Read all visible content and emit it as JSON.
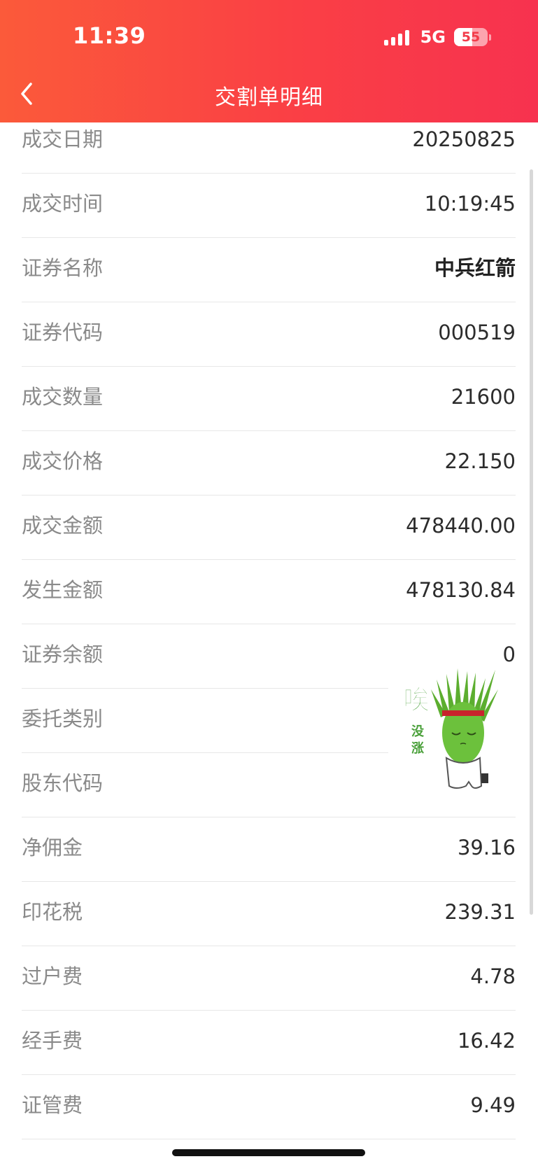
{
  "status_bar": {
    "time": "11:39",
    "network": "5G",
    "battery_level": "55",
    "battery_fraction": 0.55
  },
  "header": {
    "back_icon": "chevron-left-icon",
    "title": "交割单明细",
    "gradient_colors": [
      "#fb5a3a",
      "#f7324f"
    ]
  },
  "details": [
    {
      "key": "trade-date",
      "label": "成交日期",
      "value": "20250825"
    },
    {
      "key": "trade-time",
      "label": "成交时间",
      "value": "10:19:45"
    },
    {
      "key": "security-name",
      "label": "证券名称",
      "value": "中兵红箭"
    },
    {
      "key": "security-code",
      "label": "证券代码",
      "value": "000519"
    },
    {
      "key": "trade-quantity",
      "label": "成交数量",
      "value": "21600"
    },
    {
      "key": "trade-price",
      "label": "成交价格",
      "value": "22.150"
    },
    {
      "key": "trade-amount",
      "label": "成交金额",
      "value": "478440.00"
    },
    {
      "key": "occurred-amount",
      "label": "发生金额",
      "value": "478130.84"
    },
    {
      "key": "security-balance",
      "label": "证券余额",
      "value": "0"
    },
    {
      "key": "order-type",
      "label": "委托类别",
      "value": ""
    },
    {
      "key": "shareholder-code",
      "label": "股东代码",
      "value": ""
    },
    {
      "key": "net-commission",
      "label": "净佣金",
      "value": "39.16"
    },
    {
      "key": "stamp-tax",
      "label": "印花税",
      "value": "239.31"
    },
    {
      "key": "transfer-fee",
      "label": "过户费",
      "value": "4.78"
    },
    {
      "key": "handling-fee",
      "label": "经手费",
      "value": "16.42"
    },
    {
      "key": "regulatory-fee",
      "label": "证管费",
      "value": "9.49"
    }
  ],
  "sticker": {
    "icon": "grass-head-sticker-icon",
    "text_main": "唉",
    "text_sub_1": "没",
    "text_sub_2": "涨"
  }
}
